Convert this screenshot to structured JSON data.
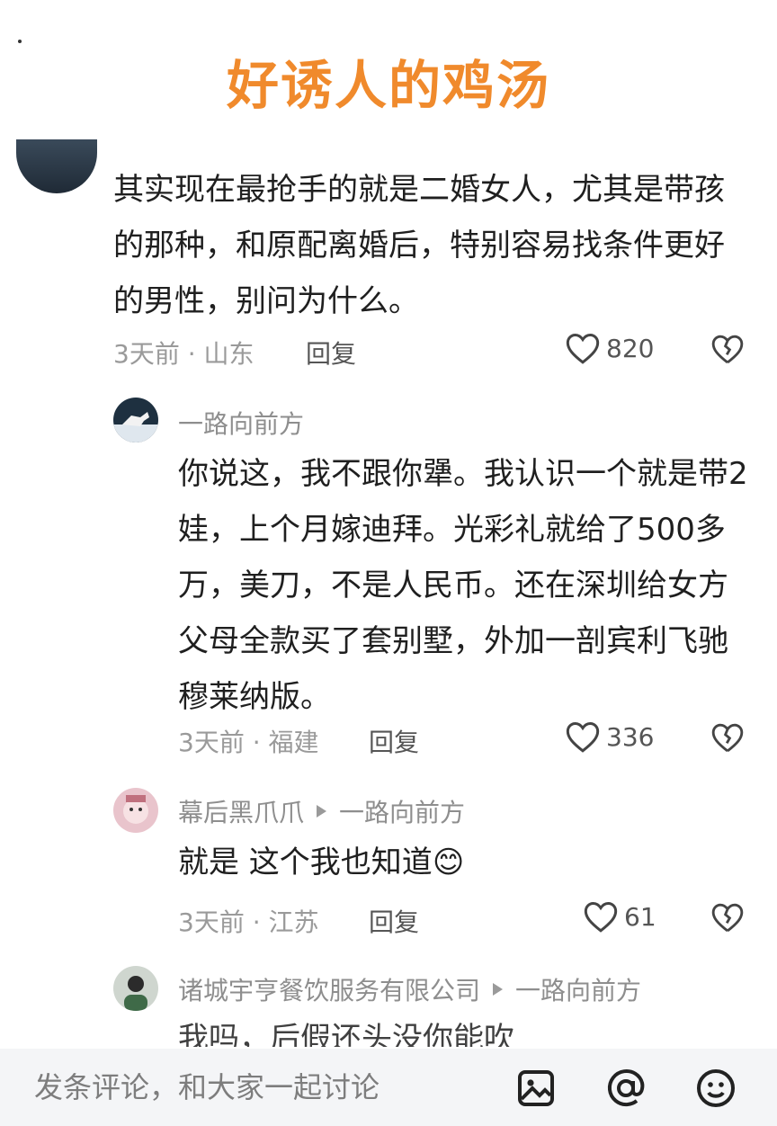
{
  "title": "好诱人的鸡汤",
  "comments": [
    {
      "name": "",
      "text": "其实现在最抢手的就是二婚女人，尤其是带孩的那种，和原配离婚后，特别容易找条件更好的男性，别问为什么。",
      "time": "3天前",
      "location": "山东",
      "reply_label": "回复",
      "likes": "820"
    },
    {
      "name": "一路向前方",
      "text": "你说这，我不跟你犟。我认识一个就是带2娃，上个月嫁迪拜。光彩礼就给了500多万，美刀，不是人民币。还在深圳给女方父母全款买了套别墅，外加一剖宾利飞驰穆莱纳版。",
      "time": "3天前",
      "location": "福建",
      "reply_label": "回复",
      "likes": "336"
    },
    {
      "name": "幕后黑爪爪",
      "reply_to": "一路向前方",
      "text": "就是 这个我也知道",
      "emoji": "😊",
      "time": "3天前",
      "location": "江苏",
      "reply_label": "回复",
      "likes": "61"
    },
    {
      "name": "诸城宇亨餐饮服务有限公司",
      "reply_to": "一路向前方",
      "text": "我吗，后假还头没你能吹"
    }
  ],
  "bottom_bar": {
    "placeholder": "发条评论，和大家一起讨论",
    "icons": [
      "image-icon",
      "at-icon",
      "emoji-icon"
    ]
  },
  "colors": {
    "title": "#f08a2c",
    "meta": "#9a9a9a",
    "text": "#1f1f1f"
  }
}
